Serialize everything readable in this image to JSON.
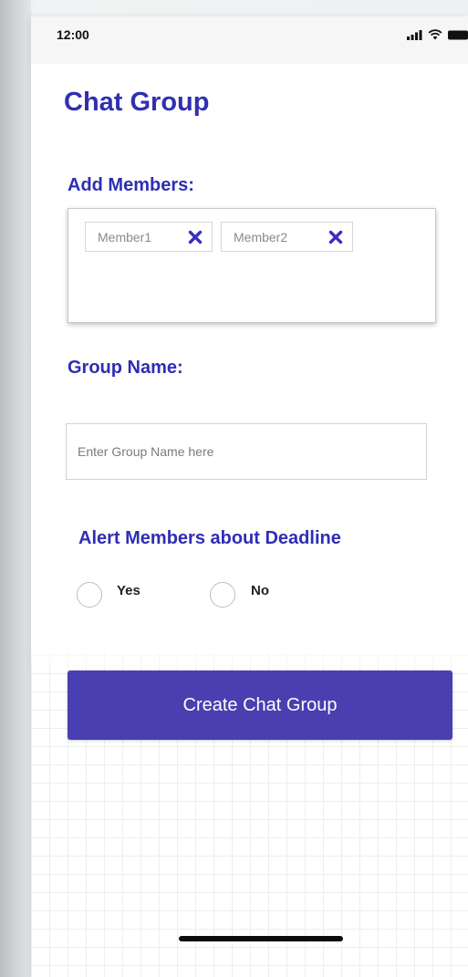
{
  "status_bar": {
    "time": "12:00"
  },
  "page": {
    "title": "Chat Group"
  },
  "members": {
    "label": "Add Members:",
    "chips": [
      {
        "label": "Member1"
      },
      {
        "label": "Member2"
      }
    ]
  },
  "group_name": {
    "label": "Group Name:",
    "placeholder": "Enter Group Name here",
    "value": ""
  },
  "alert": {
    "label": "Alert Members about Deadline",
    "options": [
      {
        "label": "Yes",
        "selected": false
      },
      {
        "label": "No",
        "selected": false
      }
    ]
  },
  "actions": {
    "create_label": "Create Chat Group"
  },
  "colors": {
    "heading": "#3030b0",
    "button": "#4a3fb0",
    "chip_close": "#3a2fc0"
  },
  "icons": {
    "signal": "cellular-signal-icon",
    "wifi": "wifi-icon",
    "battery": "battery-icon",
    "remove": "close-x-icon"
  }
}
